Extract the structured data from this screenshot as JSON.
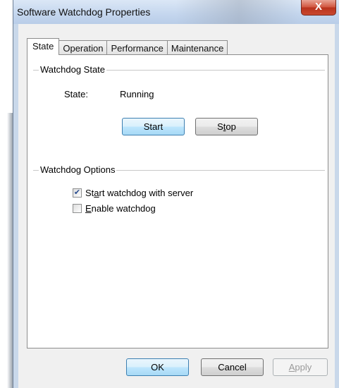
{
  "window": {
    "title": "Software Watchdog Properties",
    "close_glyph": "X"
  },
  "tabs": [
    {
      "label": "State",
      "active": true
    },
    {
      "label": "Operation",
      "active": false
    },
    {
      "label": "Performance",
      "active": false
    },
    {
      "label": "Maintenance",
      "active": false
    }
  ],
  "state_group": {
    "title": "Watchdog State",
    "state_label": "State:",
    "state_value": "Running",
    "start_label": "Start",
    "stop_label_pre": "S",
    "stop_label_ul": "t",
    "stop_label_post": "op"
  },
  "options_group": {
    "title": "Watchdog Options",
    "opt1": {
      "pre": "St",
      "ul": "a",
      "post": "rt watchdog with server",
      "checked": true
    },
    "opt2": {
      "pre": "",
      "ul": "E",
      "post": "nable watchdog",
      "checked": false
    }
  },
  "footer": {
    "ok_label": "OK",
    "cancel_label": "Cancel",
    "apply_pre": "",
    "apply_ul": "A",
    "apply_post": "pply"
  },
  "colors": {
    "accent": "#3c7fb1",
    "close": "#c9482e",
    "check": "#2a4d8f"
  }
}
